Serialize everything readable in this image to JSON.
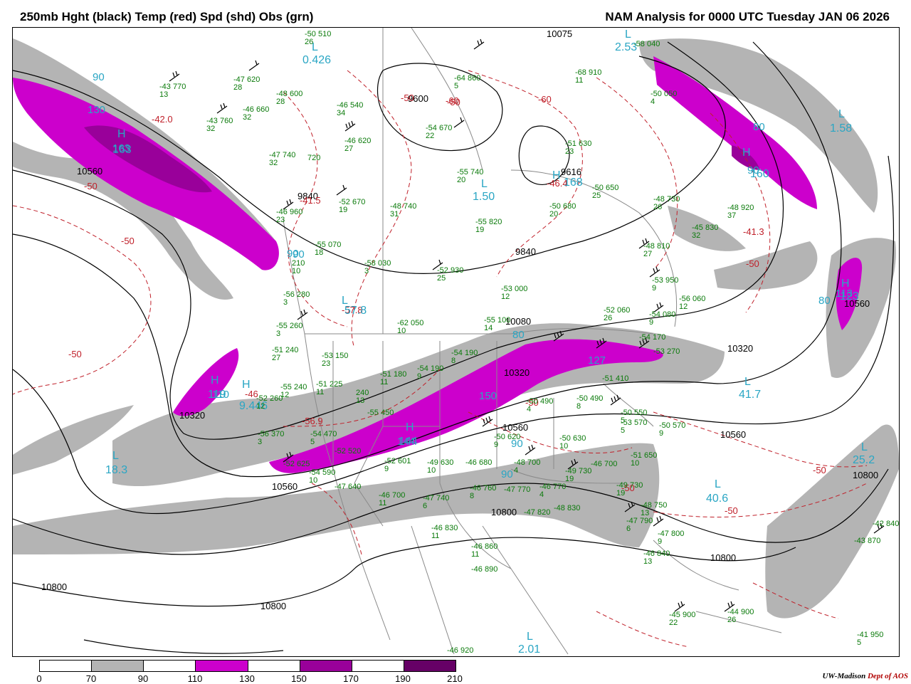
{
  "header": {
    "left_title": "250mb Hght (black) Temp (red) Spd (shd) Obs (grn)",
    "right_title": "NAM Analysis for 0000 UTC Tuesday  JAN 06 2026"
  },
  "legend": {
    "ticks": [
      "0",
      "70",
      "90",
      "110",
      "130",
      "150",
      "170",
      "190",
      "210"
    ],
    "colors": [
      "#ffffff",
      "#b4b4b4",
      "#ffffff",
      "#cc00cc",
      "#ffffff",
      "#99009a",
      "#ffffff",
      "#660066"
    ]
  },
  "credit": {
    "org": "UW-Madison",
    "dept": "Dept of AOS"
  },
  "colors": {
    "height": "#000000",
    "temperature": "#c0202a",
    "speed_label": "#2aa6c4",
    "obs": "#0a7a0a",
    "shade_70": "#b4b4b4",
    "shade_110": "#cc00cc",
    "shade_150": "#99009a",
    "shade_190": "#660066"
  },
  "height_labels": [
    "10075",
    "10560",
    "9840",
    "9600",
    "9616",
    "9840",
    "10080",
    "10320",
    "10320",
    "10320",
    "10560",
    "10560",
    "10560",
    "10800",
    "10800",
    "10800",
    "10800",
    "10800",
    "10560"
  ],
  "temp_labels": [
    "-42.0",
    "-50",
    "-50",
    "-50",
    "-41.5",
    "-50",
    "-60",
    "-60",
    "-57.8",
    "-46.4",
    "-41.3",
    "-50",
    "-50",
    "-56.9",
    "-50",
    "-46",
    "-50",
    "-50",
    "-50"
  ],
  "speed_labels": [
    "90",
    "130",
    "163",
    "90",
    "80",
    "90",
    "80",
    "127",
    "150",
    "90",
    "80",
    "110",
    "144",
    "90",
    "90",
    "113"
  ],
  "systems": [
    {
      "letter": "L",
      "value": "2.53"
    },
    {
      "letter": "L",
      "value": "0.426"
    },
    {
      "letter": "H",
      "value": "163"
    },
    {
      "letter": "L",
      "value": "1.50"
    },
    {
      "letter": "H",
      "value": "168"
    },
    {
      "letter": "L",
      "value": "1.58"
    },
    {
      "letter": "H",
      "value": "160"
    },
    {
      "letter": "L",
      "value": "18.3"
    },
    {
      "letter": "H",
      "value": "119"
    },
    {
      "letter": "H",
      "value": "9.446"
    },
    {
      "letter": "L",
      "value": "57.8"
    },
    {
      "letter": "H",
      "value": "144"
    },
    {
      "letter": "L",
      "value": "41.7"
    },
    {
      "letter": "L",
      "value": "25.2"
    },
    {
      "letter": "L",
      "value": "40.6"
    },
    {
      "letter": "L",
      "value": "2.01"
    },
    {
      "letter": "H",
      "value": "123"
    }
  ],
  "obs": [
    {
      "t": "-50",
      "h": "510",
      "d": "26"
    },
    {
      "t": "-58",
      "h": "040",
      "d": ""
    },
    {
      "t": "-43",
      "h": "770",
      "d": "13"
    },
    {
      "t": "-47",
      "h": "620",
      "d": "28"
    },
    {
      "t": "-48",
      "h": "600",
      "d": "28"
    },
    {
      "t": "-46",
      "h": "660",
      "d": "32"
    },
    {
      "t": "-43",
      "h": "760",
      "d": "32"
    },
    {
      "t": "-46",
      "h": "540",
      "d": "34"
    },
    {
      "t": "-64",
      "h": "860",
      "d": "5"
    },
    {
      "t": "-68",
      "h": "910",
      "d": "11"
    },
    {
      "t": "-50",
      "h": "050",
      "d": "4"
    },
    {
      "t": "-54",
      "h": "670",
      "d": "22"
    },
    {
      "t": "-46",
      "h": "620",
      "d": "27"
    },
    {
      "t": "-47",
      "h": "740",
      "d": "32"
    },
    {
      "t": "",
      "h": "720",
      "d": ""
    },
    {
      "t": "-51",
      "h": "630",
      "d": "23"
    },
    {
      "t": "-55",
      "h": "740",
      "d": "20"
    },
    {
      "t": "-50",
      "h": "650",
      "d": "25"
    },
    {
      "t": "-48",
      "h": "730",
      "d": "26"
    },
    {
      "t": "-50",
      "h": "680",
      "d": "20"
    },
    {
      "t": "-48",
      "h": "920",
      "d": "37"
    },
    {
      "t": "-52",
      "h": "670",
      "d": "19"
    },
    {
      "t": "-48",
      "h": "740",
      "d": "31"
    },
    {
      "t": "-46",
      "h": "960",
      "d": "23"
    },
    {
      "t": "-55",
      "h": "820",
      "d": "19"
    },
    {
      "t": "-45",
      "h": "830",
      "d": "32"
    },
    {
      "t": "-55",
      "h": "070",
      "d": "18"
    },
    {
      "t": "-58",
      "h": "030",
      "d": "3"
    },
    {
      "t": "-48",
      "h": "810",
      "d": "27"
    },
    {
      "t": "",
      "h": "210",
      "d": "10"
    },
    {
      "t": "-52",
      "h": "930",
      "d": "25"
    },
    {
      "t": "-53",
      "h": "950",
      "d": "9"
    },
    {
      "t": "-53",
      "h": "000",
      "d": "12"
    },
    {
      "t": "-56",
      "h": "280",
      "d": "3"
    },
    {
      "t": "-56",
      "h": "060",
      "d": "12"
    },
    {
      "t": "-52",
      "h": "060",
      "d": "26"
    },
    {
      "t": "-54",
      "h": "080",
      "d": "9"
    },
    {
      "t": "-55",
      "h": "260",
      "d": "3"
    },
    {
      "t": "-62",
      "h": "050",
      "d": "10"
    },
    {
      "t": "-55",
      "h": "100",
      "d": "14"
    },
    {
      "t": "-51",
      "h": "240",
      "d": "27"
    },
    {
      "t": "-53",
      "h": "150",
      "d": "23"
    },
    {
      "t": "-54",
      "h": "190",
      "d": "8"
    },
    {
      "t": "-54",
      "h": "170",
      "d": ""
    },
    {
      "t": "-53",
      "h": "270",
      "d": ""
    },
    {
      "t": "-51",
      "h": "180",
      "d": "11"
    },
    {
      "t": "-54",
      "h": "190",
      "d": "9"
    },
    {
      "t": "-51",
      "h": "410",
      "d": ""
    },
    {
      "t": "-55",
      "h": "240",
      "d": "12"
    },
    {
      "t": "-51",
      "h": "225",
      "d": "11"
    },
    {
      "t": "",
      "h": "240",
      "d": "13"
    },
    {
      "t": "-52",
      "h": "260",
      "d": "12"
    },
    {
      "t": "-50",
      "h": "490",
      "d": "4"
    },
    {
      "t": "-50",
      "h": "490",
      "d": "8"
    },
    {
      "t": "-50",
      "h": "550",
      "d": "5"
    },
    {
      "t": "-53",
      "h": "570",
      "d": "5"
    },
    {
      "t": "-50",
      "h": "570",
      "d": "9"
    },
    {
      "t": "-56",
      "h": "370",
      "d": "3"
    },
    {
      "t": "-54",
      "h": "470",
      "d": "5"
    },
    {
      "t": "-55",
      "h": "450",
      "d": ""
    },
    {
      "t": "-50",
      "h": "620",
      "d": "9"
    },
    {
      "t": "-50",
      "h": "630",
      "d": "10"
    },
    {
      "t": "-51",
      "h": "650",
      "d": "10"
    },
    {
      "t": "-52",
      "h": "520",
      "d": ""
    },
    {
      "t": "-52",
      "h": "625",
      "d": ""
    },
    {
      "t": "-52",
      "h": "601",
      "d": "9"
    },
    {
      "t": "-49",
      "h": "630",
      "d": "10"
    },
    {
      "t": "-46",
      "h": "680",
      "d": ""
    },
    {
      "t": "-48",
      "h": "700",
      "d": "4"
    },
    {
      "t": "-46",
      "h": "700",
      "d": ""
    },
    {
      "t": "-49",
      "h": "730",
      "d": "19"
    },
    {
      "t": "-49",
      "h": "730",
      "d": "19"
    },
    {
      "t": "-54",
      "h": "590",
      "d": "10"
    },
    {
      "t": "-47",
      "h": "640",
      "d": ""
    },
    {
      "t": "-46",
      "h": "700",
      "d": "11"
    },
    {
      "t": "-47",
      "h": "740",
      "d": "6"
    },
    {
      "t": "-46",
      "h": "760",
      "d": "8"
    },
    {
      "t": "-47",
      "h": "770",
      "d": ""
    },
    {
      "t": "-46",
      "h": "770",
      "d": "4"
    },
    {
      "t": "-47",
      "h": "820",
      "d": ""
    },
    {
      "t": "-48",
      "h": "750",
      "d": "13"
    },
    {
      "t": "-47",
      "h": "790",
      "d": "6"
    },
    {
      "t": "-47",
      "h": "800",
      "d": "9"
    },
    {
      "t": "-48",
      "h": "830",
      "d": ""
    },
    {
      "t": "-46",
      "h": "830",
      "d": "11"
    },
    {
      "t": "-46",
      "h": "860",
      "d": "11"
    },
    {
      "t": "-46",
      "h": "840",
      "d": "13"
    },
    {
      "t": "-46",
      "h": "890",
      "d": ""
    },
    {
      "t": "-43",
      "h": "870",
      "d": ""
    },
    {
      "t": "-42",
      "h": "840",
      "d": ""
    },
    {
      "t": "-45",
      "h": "900",
      "d": "22"
    },
    {
      "t": "-44",
      "h": "900",
      "d": "26"
    },
    {
      "t": "-41",
      "h": "950",
      "d": "5"
    },
    {
      "t": "-46",
      "h": "920",
      "d": ""
    }
  ]
}
